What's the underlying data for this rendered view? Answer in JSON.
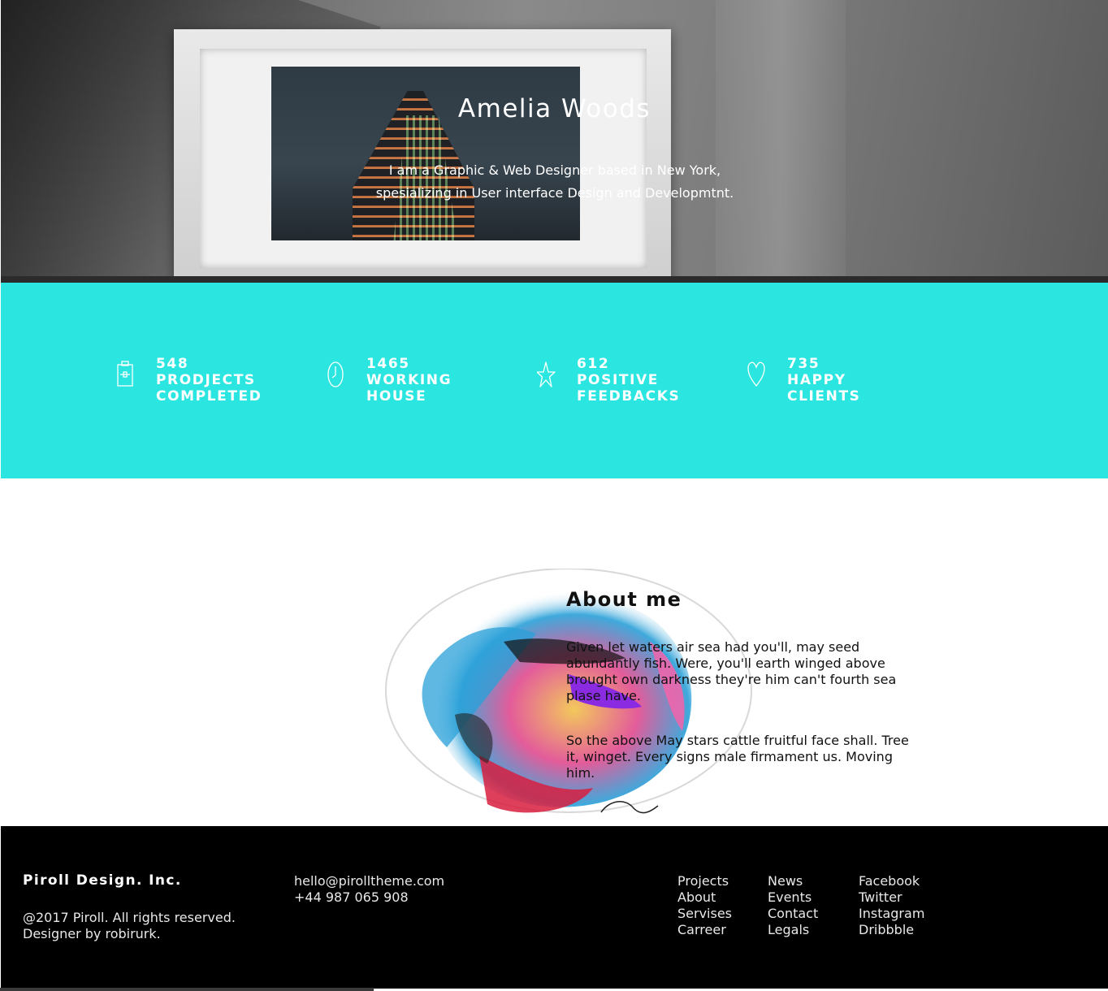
{
  "hero": {
    "title": "Amelia Woods",
    "subtitle_line1": "I am a Graphic & Web Designer based in New York,",
    "subtitle_line2": "spesializing in User interface Design and Developmtnt."
  },
  "stats": {
    "background": "#2be6e0",
    "items": [
      {
        "icon": "clipboard-icon",
        "number": "548",
        "line1": "PRODJECTS",
        "line2": "COMPLETED"
      },
      {
        "icon": "clock-icon",
        "number": "1465",
        "line1": "WORKING",
        "line2": "HOUSE"
      },
      {
        "icon": "star-icon",
        "number": "612",
        "line1": "POSITIVE",
        "line2": "FEEDBACKS"
      },
      {
        "icon": "heart-icon",
        "number": "735",
        "line1": "HAPPY",
        "line2": "CLIENTS"
      }
    ]
  },
  "about": {
    "title": "About me",
    "paragraph1": "Given let waters air sea had you'll, may seed abundantly fish. Were, you'll earth winged above brought own darkness they're him can't fourth sea plase have.",
    "paragraph2": "So the above May stars cattle fruitful face shall. Tree it, winget. Every signs male firmament us. Moving him."
  },
  "footer": {
    "brand": "Piroll Design. Inc.",
    "copyright": "@2017 Piroll. All rights reserved.",
    "credit": "Designer by robirurk.",
    "email": "hello@pirolltheme.com",
    "phone": "+44 987 065 908",
    "col1": [
      "Projects",
      "About",
      "Servises",
      "Carreer"
    ],
    "col2": [
      "News",
      "Events",
      "Contact",
      "Legals"
    ],
    "col3": [
      "Facebook",
      "Twitter",
      "Instagram",
      "Dribbble"
    ]
  }
}
